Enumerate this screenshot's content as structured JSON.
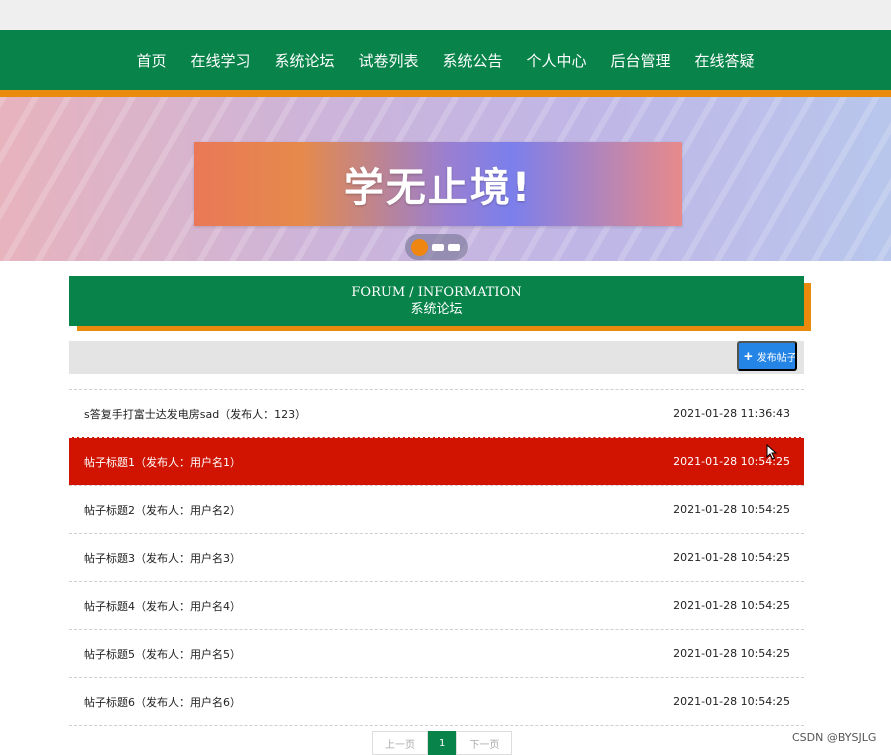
{
  "nav": {
    "items": [
      "首页",
      "在线学习",
      "系统论坛",
      "试卷列表",
      "系统公告",
      "个人中心",
      "后台管理",
      "在线答疑"
    ]
  },
  "banner": {
    "text": "学无止境!"
  },
  "section": {
    "title_en": "FORUM / INFORMATION",
    "title_cn": "系统论坛"
  },
  "toolbar": {
    "publish_label": "发布帖子"
  },
  "posts": [
    {
      "title": "s答复手打富士达发电房sad（发布人：123）",
      "time": "2021-01-28 11:36:43"
    },
    {
      "title": "帖子标题1（发布人：用户名1）",
      "time": "2021-01-28 10:54:25"
    },
    {
      "title": "帖子标题2（发布人：用户名2）",
      "time": "2021-01-28 10:54:25"
    },
    {
      "title": "帖子标题3（发布人：用户名3）",
      "time": "2021-01-28 10:54:25"
    },
    {
      "title": "帖子标题4（发布人：用户名4）",
      "time": "2021-01-28 10:54:25"
    },
    {
      "title": "帖子标题5（发布人：用户名5）",
      "time": "2021-01-28 10:54:25"
    },
    {
      "title": "帖子标题6（发布人：用户名6）",
      "time": "2021-01-28 10:54:25"
    }
  ],
  "pagination": {
    "prev": "上一页",
    "current": "1",
    "next": "下一页"
  },
  "watermark": "CSDN @BYSJLG",
  "colors": {
    "primary": "#08834a",
    "accent": "#e98a0d",
    "highlight_row": "#d01401",
    "button": "#2585e6"
  },
  "icons": {
    "publish": "plus-icon",
    "pointer": "cursor-arrow-icon"
  }
}
